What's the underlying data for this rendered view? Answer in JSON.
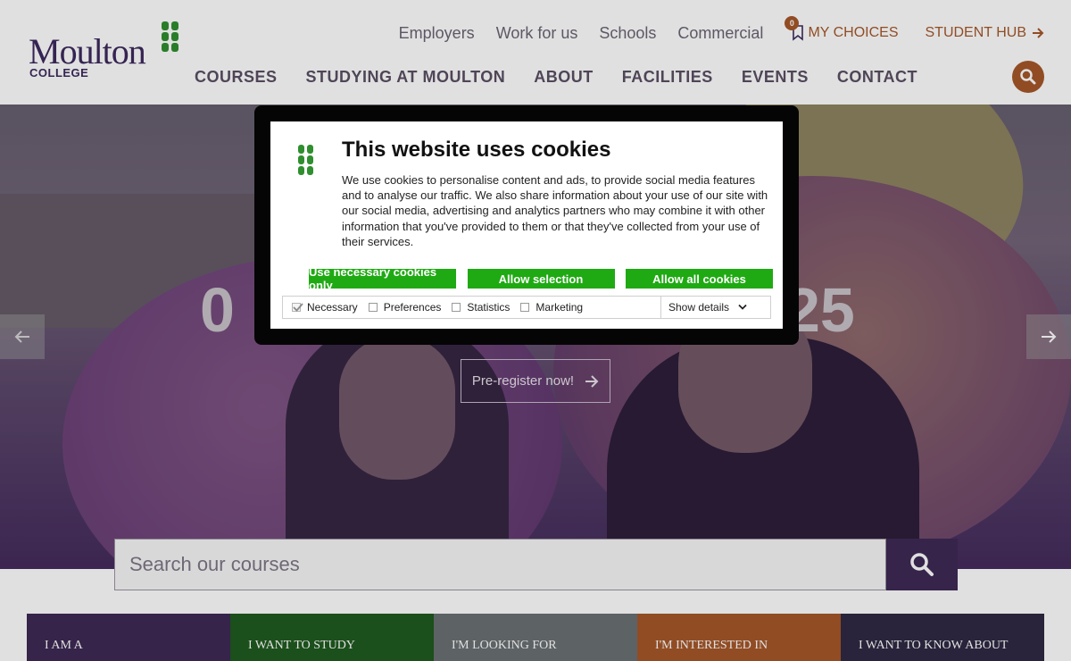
{
  "header": {
    "logo_text": "Moulton",
    "logo_sub": "COLLEGE",
    "top_links": [
      "Employers",
      "Work for us",
      "Schools",
      "Commercial"
    ],
    "my_choices_label": "MY CHOICES",
    "my_choices_count": "0",
    "student_hub_label": "STUDENT HUB",
    "nav": [
      "COURSES",
      "STUDYING AT MOULTON",
      "ABOUT",
      "FACILITIES",
      "EVENTS",
      "CONTACT"
    ]
  },
  "hero": {
    "title_left": "0",
    "title_right": "25",
    "cta_label": "Pre-register now!"
  },
  "search": {
    "placeholder": "Search our courses"
  },
  "quick_links": [
    {
      "label": "I AM A",
      "color": "#3e2a55"
    },
    {
      "label": "I WANT TO STUDY",
      "color": "#1f5a1f"
    },
    {
      "label": "I'M LOOKING FOR",
      "color": "#6a7072"
    },
    {
      "label": "I'M INTERESTED IN",
      "color": "#a5572a"
    },
    {
      "label": "I WANT TO KNOW ABOUT",
      "color": "#2f2a44"
    }
  ],
  "cookie": {
    "title": "This website uses cookies",
    "text": "We use cookies to personalise content and ads, to provide social media features and to analyse our traffic. We also share information about your use of our site with our social media, advertising and analytics partners who may combine it with other information that you've provided to them or that they've collected from your use of their services.",
    "buttons": {
      "necessary": "Use necessary cookies only",
      "selection": "Allow selection",
      "all": "Allow all cookies"
    },
    "options": {
      "necessary": "Necessary",
      "preferences": "Preferences",
      "statistics": "Statistics",
      "marketing": "Marketing"
    },
    "show_details": "Show details",
    "button_color": "#1faa13"
  },
  "colors": {
    "brand_purple": "#3d2a5e",
    "accent_orange": "#a5572a",
    "brand_green": "#2f8f2f"
  }
}
